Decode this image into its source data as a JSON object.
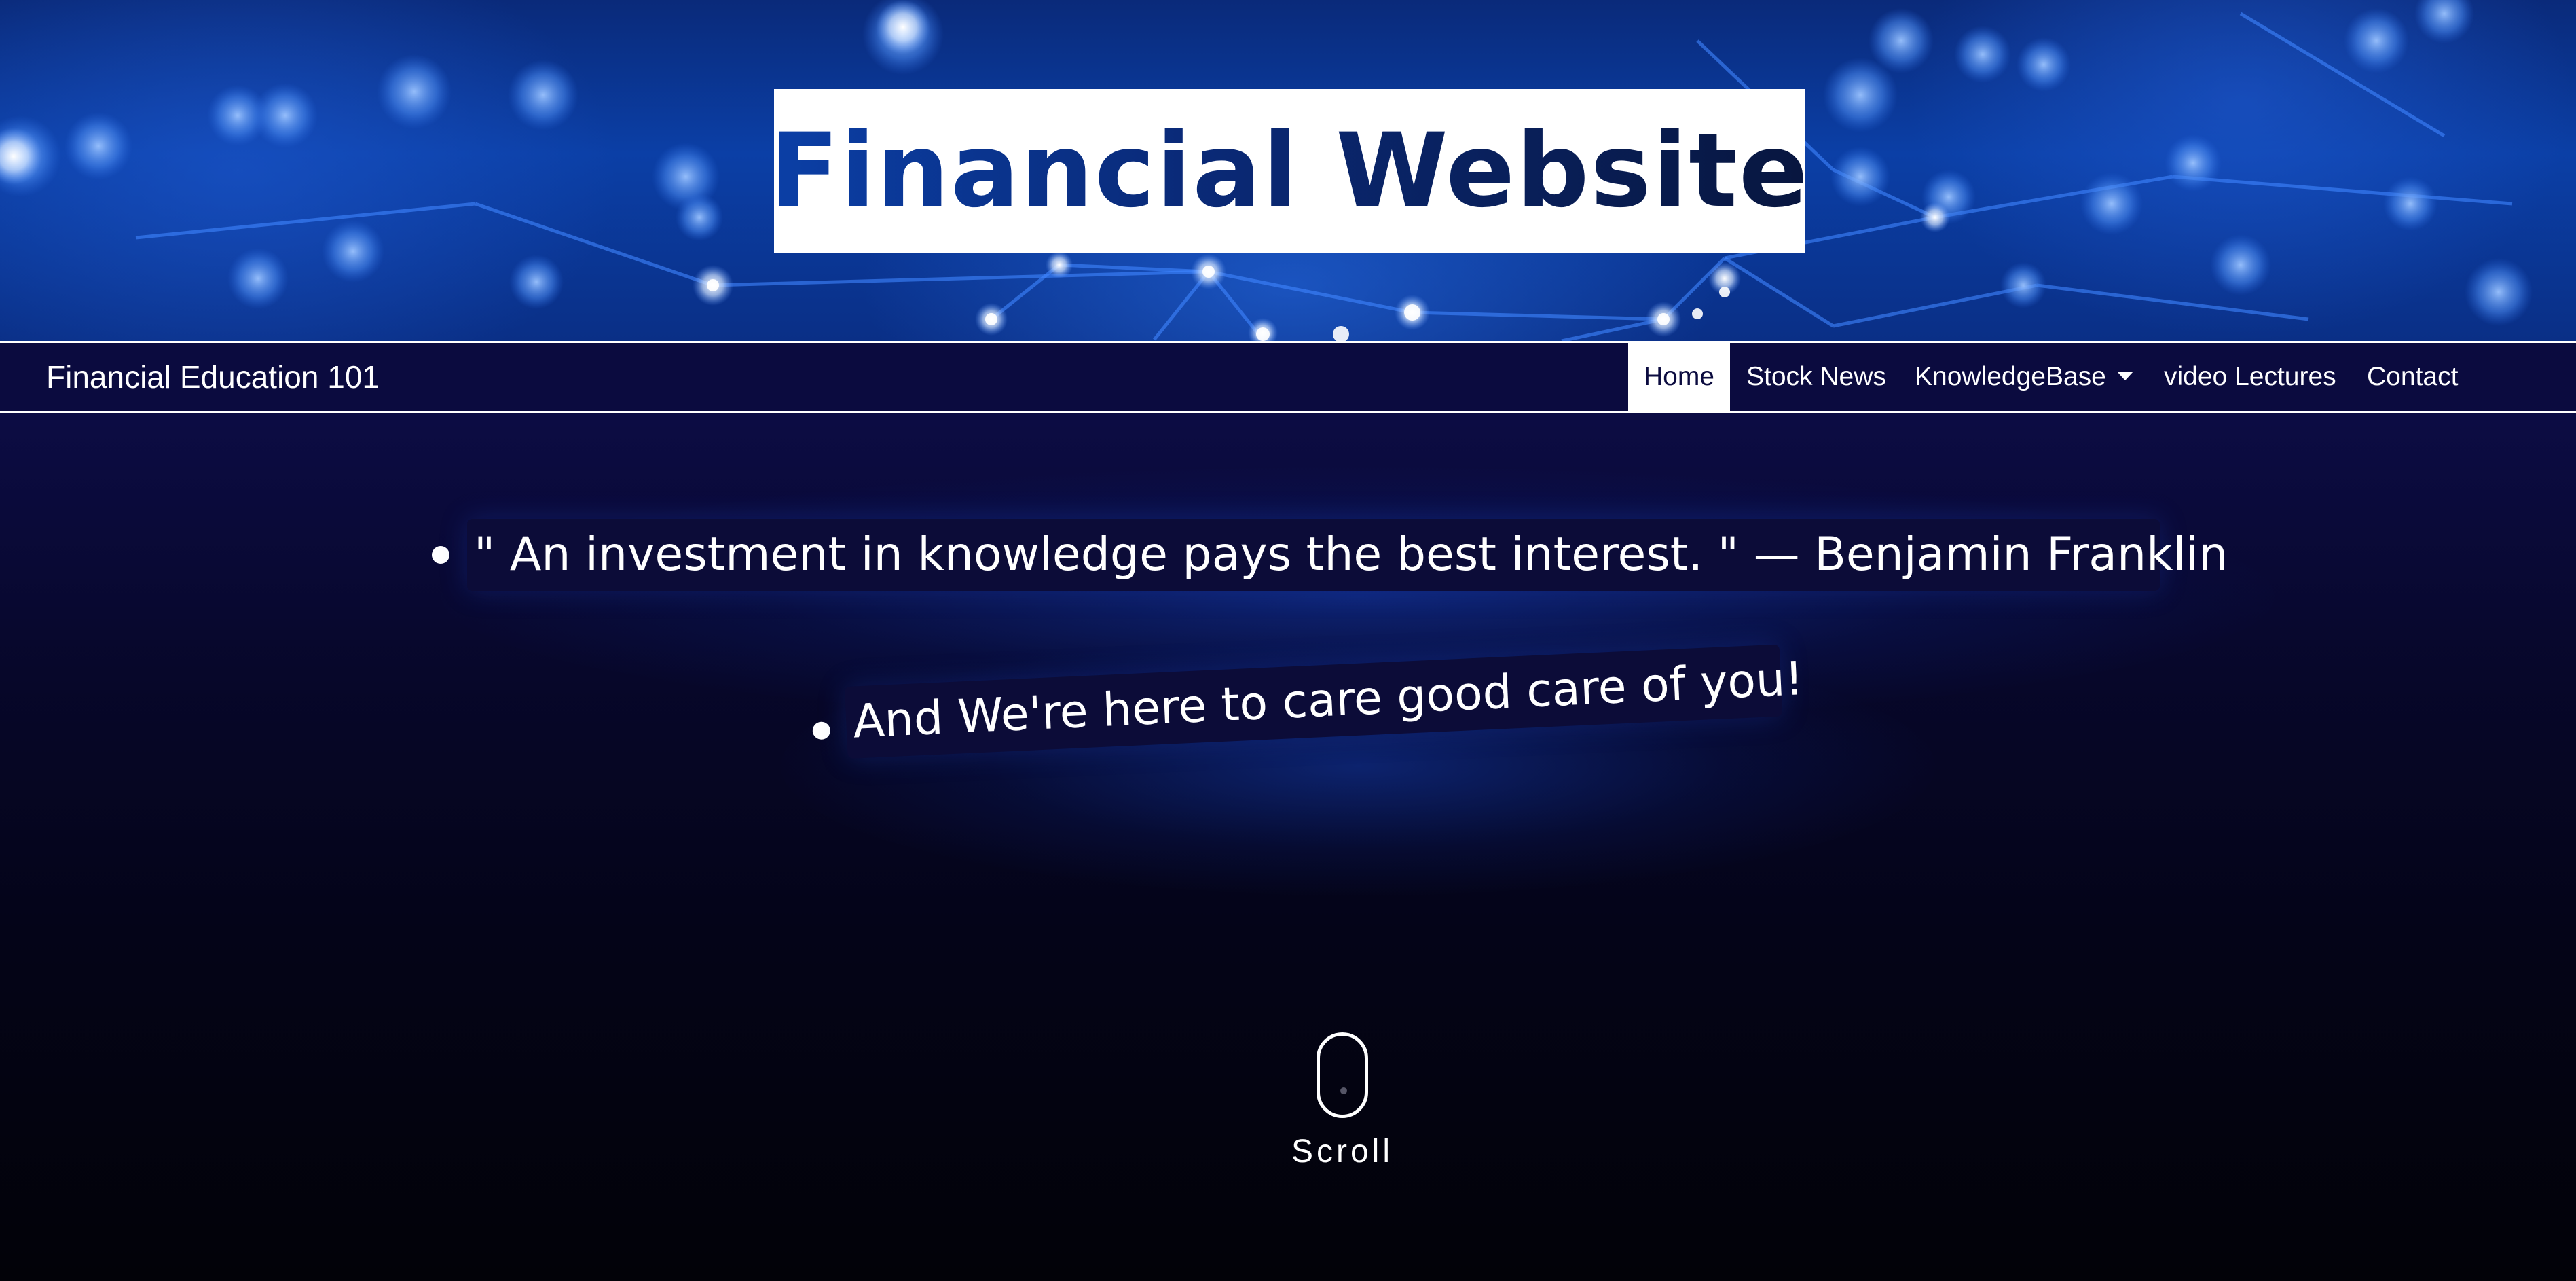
{
  "hero": {
    "title": "Financial Website",
    "background_icon": "network-nodes"
  },
  "navbar": {
    "brand": "Financial Education 101",
    "items": [
      {
        "label": "Home",
        "active": true
      },
      {
        "label": "Stock News",
        "active": false
      },
      {
        "label": "KnowledgeBase",
        "active": false,
        "has_dropdown": true
      },
      {
        "label": "video Lectures",
        "active": false
      },
      {
        "label": "Contact",
        "active": false
      }
    ]
  },
  "main": {
    "quotes": [
      "\" An investment in knowledge pays the best interest. \" — Benjamin Franklin",
      "And We're here to care good care of you!"
    ],
    "scroll_label": "Scroll",
    "scroll_icon": "mouse-icon"
  },
  "colors": {
    "navbar_bg": "#0b0b3f",
    "title_gradient_start": "#0b3fa6",
    "title_gradient_end": "#08163f",
    "accent_blue": "#1446c8"
  }
}
